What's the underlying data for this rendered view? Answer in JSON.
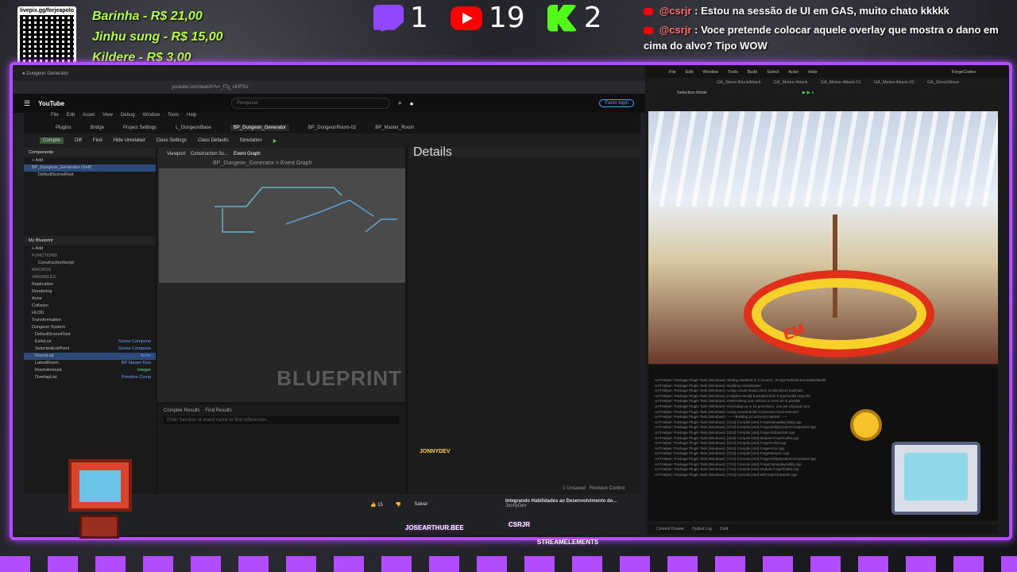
{
  "overlay": {
    "qr_caption": "livepix.gg/forjeapolo",
    "donations": [
      {
        "text": "Barinha - R$ 21,00"
      },
      {
        "text": "Jinhu sung - R$ 15,00"
      },
      {
        "text": "Kildere - R$ 3,00"
      }
    ],
    "counters": {
      "twitch": "1",
      "youtube": "19",
      "kick": "2"
    },
    "chat": [
      {
        "user": "@csrjr",
        "message": ": Estou na sessão de UI em GAS, muito chato kkkkk"
      },
      {
        "user": "@csrjr",
        "message": ": Voce pretende colocar aquele overlay que mostra o dano em cima do alvo? Tipo WOW"
      }
    ],
    "alerts": {
      "a1": "JOSEARTHUR.BEE",
      "a2": "CSRJR",
      "a3": "STREAMELEMENTS"
    },
    "accent_color": "#b34cff",
    "donor_color": "#b6ff3c"
  },
  "browser": {
    "url": "youtube.com/watch?v=_f7g_cKIF0U",
    "search_placeholder": "Pesquisar",
    "login_label": "Fazer login",
    "logo": "YouTube",
    "likes": "15",
    "save_label": "Salvar",
    "suggestion_title": "Integrando Habilidades ao Desenvolvimento de...",
    "suggestion_channel": "JonnyDev"
  },
  "unreal": {
    "menu": [
      "File",
      "Edit",
      "Asset",
      "View",
      "Debug",
      "Window",
      "Tools",
      "Help"
    ],
    "tabs": [
      "Plugins",
      "Bridge",
      "Project Settings",
      "L_DungeonBase",
      "BP_Dungeon_Generator",
      "BP_DungeonRoom-02",
      "BP_Master_Room"
    ],
    "toolbar": [
      "Compile",
      "Diff",
      "Find",
      "Hide Unrelated",
      "Class Settings",
      "Class Defaults",
      "Simulation"
    ],
    "components_title": "Components",
    "components": [
      "BP_Dungeon_Generator (Self)",
      "DefaultSceneRoot"
    ],
    "myblueprint_title": "My Blueprint",
    "functions": [
      "FUNCTIONS",
      "ConstructionScript",
      "MACROS",
      "VARIABLES"
    ],
    "variable_groups": [
      "Replication",
      "Rendering",
      "Actor",
      "Collision",
      "HLOD",
      "Transformation",
      "Dungeon System"
    ],
    "variables": [
      {
        "name": "DefaultSceneRoot",
        "type": ""
      },
      {
        "name": "ExitsList",
        "type": "Scene Compone"
      },
      {
        "name": "SelectedExitPoint",
        "type": "Scene Compone"
      },
      {
        "name": "RoomList",
        "type": "Actor"
      },
      {
        "name": "LatestRoom",
        "type": "BP Master Roo"
      },
      {
        "name": "RoomAmount",
        "type": "Integer"
      },
      {
        "name": "OverlapList",
        "type": "Primitive Comp"
      }
    ],
    "graph_tabs": [
      "Viewport",
      "Construction Sc...",
      "Event Graph"
    ],
    "breadcrumb": "BP_Dungeon_Generator > Event Graph",
    "details_title": "Details",
    "blueprint_mark": "BLUEPRINT",
    "compiler_tabs": [
      "Compiler Results",
      "Find Results"
    ],
    "compiler_placeholder": "Enter function or event name to find references...",
    "status": [
      "1 Unsaved",
      "Revision Control"
    ],
    "watermark": "JONNYDEV"
  },
  "game_editor": {
    "title": "ForgeCodes",
    "menu": [
      "File",
      "Edit",
      "Window",
      "Tools",
      "Build",
      "Select",
      "Actor",
      "Help"
    ],
    "tabs": [
      "GA_Steve-BlockAttack",
      "GA_Melee-Attack",
      "GA_Melee-Attack-01",
      "GA_Melee-Attack-02",
      "GA_ShockWave"
    ],
    "mode": "Selection Mode",
    "floor_text": "EM",
    "log_lines": [
      "UATHelper: Package Plugin Task (Windows): Writing manifest to C:\\Users\\...\\ForgeToolkit\\Intermediate\\Build",
      "UATHelper: Package Plugin Task (Windows): Building UnrealGame",
      "UATHelper: Package Plugin Task (Windows): Using Visual Studio 2022 14.38.33143 toolchain",
      "UATHelper: Package Plugin Task (Windows): [Adaptive Build] Excluded from ForgeToolkit unity file",
      "UATHelper: Package Plugin Task (Windows): Determining max actions to execute in parallel",
      "UATHelper: Package Plugin Task (Windows): Executing up to 24 processes, one per physical core",
      "UATHelper: Package Plugin Task (Windows): Using Unreal Build Accelerator local executor",
      "UATHelper: Package Plugin Task (Windows): ------ Building 12 action(s) started ------",
      "UATHelper: Package Plugin Task (Windows): [1/12] Compile [x64] ForgeGameplayAbility.cpp",
      "UATHelper: Package Plugin Task (Windows): [2/12] Compile [x64] ForgeAbilitySystemComponent.cpp",
      "UATHelper: Package Plugin Task (Windows): [3/12] Compile [x64] ForgeAttributeSet.cpp",
      "UATHelper: Package Plugin Task (Windows): [4/12] Compile [x64] Module.ForgeToolkit.cpp",
      "UATHelper: Package Plugin Task (Windows): [5/12] Compile [x64] ForgeToolkit.cpp",
      "UATHelper: Package Plugin Task (Windows): [6/12] Compile [x64] ForgeActor.cpp",
      "UATHelper: Package Plugin Task (Windows): [7/12] Compile [x64] ForgeWeapon.cpp",
      "UATHelper: Package Plugin Task (Windows): [7/12] Console [x64] ForgeAbilitySystemComponent.cpp",
      "UATHelper: Package Plugin Task (Windows): [7/12] Console [x64] ForgeGameplayAbility.cpp",
      "UATHelper: Package Plugin Task (Windows): [7/12] Console [x64] Module.ForgeToolkit.cpp",
      "UATHelper: Package Plugin Task (Windows): [7/12] Console [x64] WeForgeCharacter.cpp"
    ],
    "status": [
      "Content Drawer",
      "Output Log",
      "Cmd"
    ]
  }
}
